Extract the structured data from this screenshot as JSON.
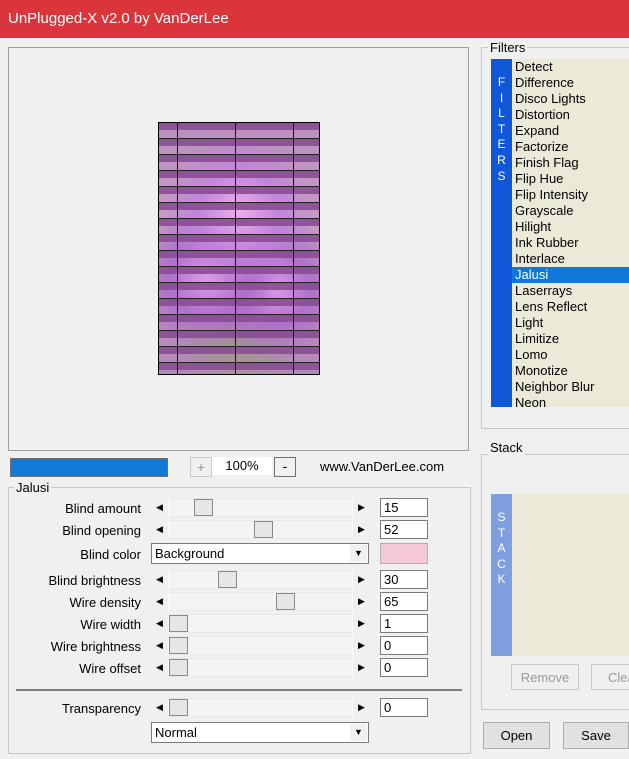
{
  "window": {
    "title": "UnPlugged-X v2.0 by VanDerLee"
  },
  "preview": {
    "zoom": "100%",
    "zoom_plus": "+",
    "zoom_minus": "-",
    "website": "www.VanDerLee.com",
    "progress": 1.0
  },
  "params": {
    "group_title": "Jalusi",
    "blind_amount": {
      "label": "Blind amount",
      "value": "15",
      "level": 0.15
    },
    "blind_opening": {
      "label": "Blind opening",
      "value": "52",
      "level": 0.52
    },
    "blind_color": {
      "label": "Blind color",
      "option": "Background",
      "swatch": "#f5c8d8"
    },
    "blind_brightness": {
      "label": "Blind brightness",
      "value": "30",
      "level": 0.3
    },
    "wire_density": {
      "label": "Wire density",
      "value": "65",
      "level": 0.65
    },
    "wire_width": {
      "label": "Wire width",
      "value": "1",
      "level": 0.0
    },
    "wire_brightness": {
      "label": "Wire brightness",
      "value": "0",
      "level": 0.0
    },
    "wire_offset": {
      "label": "Wire offset",
      "value": "0",
      "level": 0.0
    },
    "transparency": {
      "label": "Transparency",
      "value": "0",
      "level": 0.0
    },
    "blend_mode": "Normal"
  },
  "filters": {
    "title": "Filters",
    "vertical_label": [
      "F",
      "I",
      "L",
      "T",
      "E",
      "R",
      "S"
    ],
    "items": [
      "Detect",
      "Difference",
      "Disco Lights",
      "Distortion",
      "Expand",
      "Factorize",
      "Finish Flag",
      "Flip Hue",
      "Flip Intensity",
      "Grayscale",
      "Hilight",
      "Ink Rubber",
      "Interlace",
      "Jalusi",
      "Laserrays",
      "Lens Reflect",
      "Light",
      "Limitize",
      "Lomo",
      "Monotize",
      "Neighbor Blur",
      "Neon"
    ],
    "selected": "Jalusi"
  },
  "stack": {
    "title": "Stack",
    "vertical_label": [
      "S",
      "T",
      "A",
      "C",
      "K"
    ],
    "remove": "Remove",
    "clear": "Clear"
  },
  "buttons": {
    "open": "Open",
    "save": "Save"
  },
  "colors": {
    "title_bar": "#d9353b",
    "selection": "#0f78d8",
    "filters_bar": "#0f57d8",
    "stack_bar": "#7f9fe0",
    "list_bg": "#ebe9d8"
  }
}
